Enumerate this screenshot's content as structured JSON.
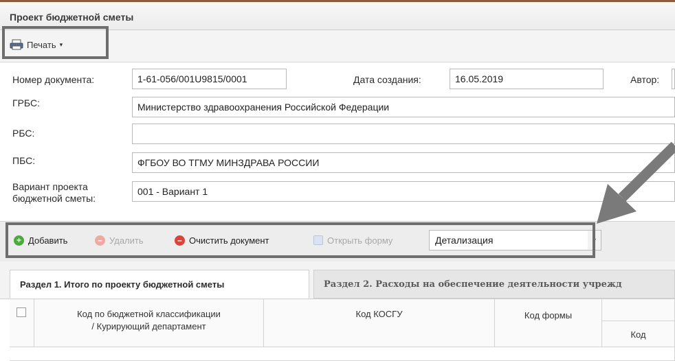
{
  "window": {
    "title": "Проект бюджетной сметы"
  },
  "toolbar": {
    "print_label": "Печать",
    "print_icon": "printer-icon",
    "caret_icon": "▾"
  },
  "form": {
    "doc_number_label": "Номер документа:",
    "doc_number_value": "1-61-056/001U9815/0001",
    "date_label": "Дата создания:",
    "date_value": "16.05.2019",
    "author_label": "Автор:",
    "author_value": "",
    "grbs_label": "ГРБС:",
    "grbs_value": "Министерство здравоохранения Российской Федерации",
    "rbs_label": "РБС:",
    "rbs_value": "",
    "pbs_label": "ПБС:",
    "pbs_value": "ФГБОУ ВО ТГМУ МИНЗДРАВА РОССИИ",
    "variant_label_line1": "Вариант проекта",
    "variant_label_line2": "бюджетной сметы:",
    "variant_value": "001 - Вариант 1"
  },
  "actions": {
    "add": "Добавить",
    "delete": "Удалить",
    "clear": "Очистить документ",
    "open_form": "Открыть форму",
    "detail_select": "Детализация"
  },
  "tabs": [
    {
      "label": "Раздел 1. Итого по проекту бюджетной сметы"
    },
    {
      "label": "Раздел 2. Расходы на обеспечение деятельности учрежд"
    }
  ],
  "grid": {
    "col_budget_line1": "Код по бюджетной классификации",
    "col_budget_line2": "/ Курирующий департамент",
    "col_kosgu": "Код КОСГУ",
    "col_form": "Код формы",
    "col_code": "Код"
  },
  "colors": {
    "highlight": "#6e6e6e",
    "add": "#4caa3c",
    "clear": "#d9453b"
  }
}
